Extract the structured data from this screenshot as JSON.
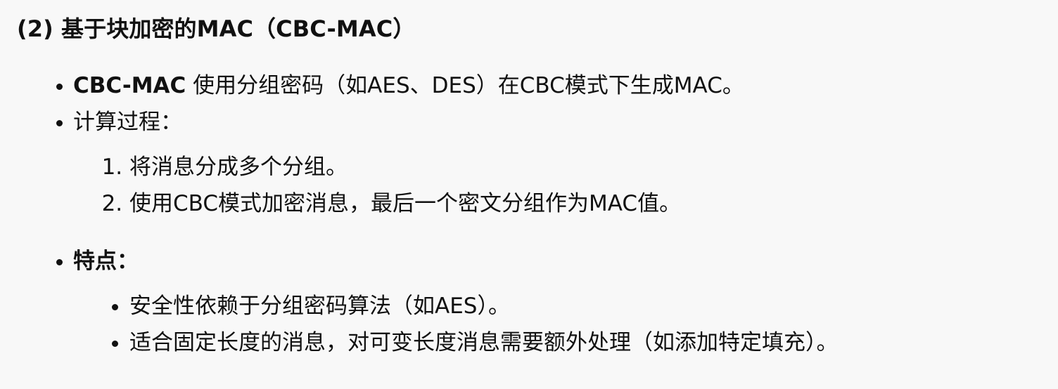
{
  "document": {
    "heading": "(2) 基于块加密的MAC（CBC-MAC）",
    "bullets": [
      {
        "bold": "CBC-MAC",
        "text": " 使用分组密码（如AES、DES）在CBC模式下生成MAC。"
      },
      {
        "text": "计算过程："
      },
      {
        "bold": "特点："
      }
    ],
    "steps": [
      "将消息分成多个分组。",
      "使用CBC模式加密消息，最后一个密文分组作为MAC值。"
    ],
    "features": [
      "安全性依赖于分组密码算法（如AES）。",
      "适合固定长度的消息，对可变长度消息需要额外处理（如添加特定填充）。"
    ]
  }
}
